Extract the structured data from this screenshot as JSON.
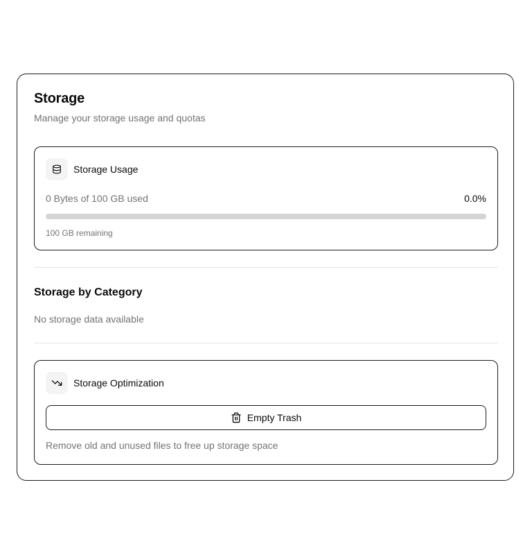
{
  "header": {
    "title": "Storage",
    "subtitle": "Manage your storage usage and quotas"
  },
  "usage": {
    "title": "Storage Usage",
    "icon": "database-icon",
    "used_text": "0 Bytes of 100 GB used",
    "percent_text": "0.0%",
    "percent_value": 0.0,
    "remaining_text": "100 GB remaining"
  },
  "category": {
    "title": "Storage by Category",
    "empty_text": "No storage data available"
  },
  "optimization": {
    "title": "Storage Optimization",
    "icon": "trending-down-icon",
    "button_label": "Empty Trash",
    "button_icon": "trash-icon",
    "note": "Remove old and unused files to free up storage space"
  },
  "colors": {
    "border": "#1a1a1a",
    "muted_text": "#737373",
    "track": "#d4d4d4",
    "icon_bg": "#f4f4f5"
  }
}
